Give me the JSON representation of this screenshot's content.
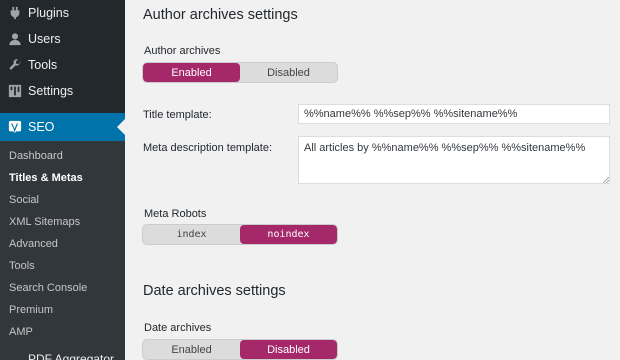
{
  "sidebar": {
    "items": [
      {
        "label": "Plugins",
        "icon": "plugins-icon"
      },
      {
        "label": "Users",
        "icon": "users-icon"
      },
      {
        "label": "Tools",
        "icon": "wrench-icon"
      },
      {
        "label": "Settings",
        "icon": "settings-icon"
      }
    ],
    "seo": {
      "label": "SEO",
      "icon": "yoast-icon"
    },
    "submenu": [
      {
        "label": "Dashboard"
      },
      {
        "label": "Titles & Metas",
        "current": true
      },
      {
        "label": "Social"
      },
      {
        "label": "XML Sitemaps"
      },
      {
        "label": "Advanced"
      },
      {
        "label": "Tools"
      },
      {
        "label": "Search Console"
      },
      {
        "label": "Premium"
      },
      {
        "label": "AMP"
      }
    ],
    "overflow_label": "PDF Aggregator"
  },
  "author_section": {
    "title": "Author archives settings",
    "archives_label": "Author archives",
    "archives_toggle": {
      "on": "Enabled",
      "off": "Disabled",
      "selected": "Enabled"
    },
    "title_template_label": "Title template:",
    "title_template_value": "%%name%% %%sep%% %%sitename%%",
    "meta_desc_label": "Meta description template:",
    "meta_desc_value": "All articles by %%name%% %%sep%% %%sitename%%",
    "robots_label": "Meta Robots",
    "robots_toggle": {
      "a": "index",
      "b": "noindex",
      "selected": "noindex"
    }
  },
  "date_section": {
    "title": "Date archives settings",
    "archives_label": "Date archives",
    "archives_toggle": {
      "on": "Enabled",
      "off": "Disabled",
      "selected": "Disabled"
    }
  },
  "colors": {
    "sidebar_bg": "#23282d",
    "submenu_bg": "#32373c",
    "active_blue": "#0073aa",
    "toggle_accent": "#a4286a",
    "page_bg": "#f1f1f1"
  }
}
